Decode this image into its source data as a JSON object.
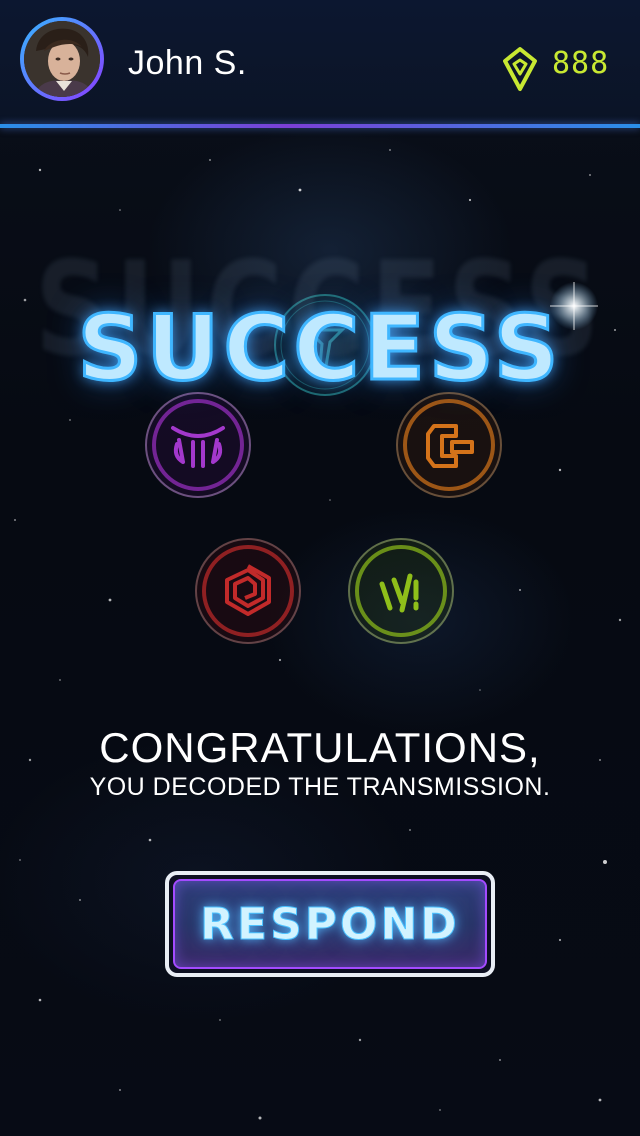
{
  "header": {
    "username": "John S.",
    "gem_count": "888",
    "avatar_alt": "user avatar",
    "gem_icon": "gem-icon",
    "accent_color": "#c8e832"
  },
  "main": {
    "title": "SUCCESS",
    "glyphs": [
      {
        "name": "teal-glyph-icon",
        "color": "#2fa7a5"
      },
      {
        "name": "purple-glyph-icon",
        "color": "#9b2fc4"
      },
      {
        "name": "orange-glyph-icon",
        "color": "#d4731a"
      },
      {
        "name": "red-glyph-icon",
        "color": "#c22a2a"
      },
      {
        "name": "green-glyph-icon",
        "color": "#8fbf1a"
      }
    ],
    "headline": "CONGRATULATIONS,",
    "subline": "YOU DECODED THE TRANSMISSION.",
    "respond_label": "RESPOND"
  },
  "colors": {
    "title_glow": "#3fb6ff",
    "header_line_start": "#2a8fe8",
    "header_line_mid": "#7b3fd6",
    "button_border": "#a34bff"
  }
}
